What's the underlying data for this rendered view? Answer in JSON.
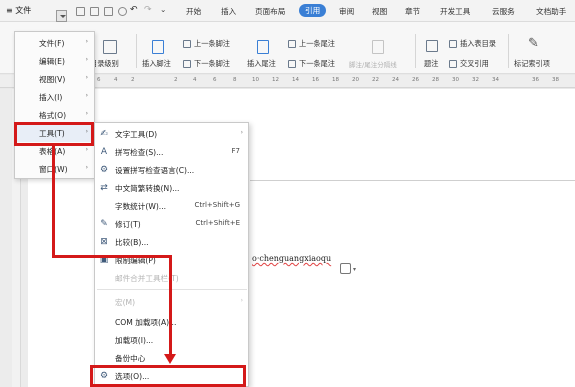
{
  "menubar": {
    "file_label": "≡ 文件",
    "tabs": [
      {
        "label": "开始"
      },
      {
        "label": "插入"
      },
      {
        "label": "页面布局"
      },
      {
        "label": "引用"
      },
      {
        "label": "审阅"
      },
      {
        "label": "视图"
      },
      {
        "label": "章节"
      },
      {
        "label": "开发工具"
      },
      {
        "label": "云服务"
      },
      {
        "label": "文档助手"
      }
    ],
    "active_tab": "引用"
  },
  "ribbon": {
    "toc_level": "目录级别",
    "insert_footnote": "插入脚注",
    "prev_footnote": "上一条脚注",
    "next_footnote": "下一条脚注",
    "insert_endnote": "插入尾注",
    "prev_endnote": "上一条尾注",
    "next_endnote": "下一条尾注",
    "footnote_separator": "脚注/尾注分隔线",
    "caption": "题注",
    "insert_table_of_figures": "插入表目录",
    "cross_reference": "交叉引用",
    "mark_index_entry": "标记索引项"
  },
  "ruler": {
    "numbers": [
      "6",
      "4",
      "2",
      "2",
      "4",
      "6",
      "8",
      "10",
      "12",
      "14",
      "16",
      "18",
      "20",
      "22",
      "24",
      "26",
      "28",
      "30",
      "32",
      "34",
      "36",
      "38"
    ]
  },
  "file_menu": {
    "items": [
      {
        "label": "文件(F)",
        "has_arrow": true
      },
      {
        "label": "编辑(E)",
        "has_arrow": true
      },
      {
        "label": "视图(V)",
        "has_arrow": true
      },
      {
        "label": "插入(I)",
        "has_arrow": true
      },
      {
        "label": "格式(O)",
        "has_arrow": true
      },
      {
        "label": "工具(T)",
        "has_arrow": true
      },
      {
        "label": "表格(A)",
        "has_arrow": true
      },
      {
        "label": "窗口(W)",
        "has_arrow": true
      }
    ],
    "arrow_glyph": "›"
  },
  "tools_menu": {
    "items": [
      {
        "label": "文字工具(D)",
        "icon": "text-tool-icon",
        "shortcut": "",
        "arrow": "›",
        "disabled": false
      },
      {
        "label": "拼写检查(S)...",
        "icon": "spell-check-icon",
        "shortcut": "F7",
        "arrow": "",
        "disabled": false
      },
      {
        "label": "设置拼写检查语言(C)...",
        "icon": "spell-language-icon",
        "shortcut": "",
        "arrow": "",
        "disabled": false
      },
      {
        "label": "中文简繁转换(N)...",
        "icon": "chinese-convert-icon",
        "shortcut": "",
        "arrow": "",
        "disabled": false
      },
      {
        "label": "字数统计(W)...",
        "icon": "",
        "shortcut": "Ctrl+Shift+G",
        "arrow": "",
        "disabled": false
      },
      {
        "label": "修订(T)",
        "icon": "revision-icon",
        "shortcut": "Ctrl+Shift+E",
        "arrow": "",
        "disabled": false
      },
      {
        "label": "比较(B)...",
        "icon": "compare-icon",
        "shortcut": "",
        "arrow": "",
        "disabled": false
      },
      {
        "label": "限制编辑(P)",
        "icon": "restrict-edit-icon",
        "shortcut": "",
        "arrow": "",
        "disabled": false
      },
      {
        "label": "邮件合并工具栏(T)",
        "icon": "",
        "shortcut": "",
        "arrow": "",
        "disabled": true
      },
      {
        "label": "宏(M)",
        "icon": "",
        "shortcut": "",
        "arrow": "›",
        "disabled": true
      },
      {
        "label": "COM 加载项(A)...",
        "icon": "",
        "shortcut": "",
        "arrow": "",
        "disabled": false
      },
      {
        "label": "加载项(I)...",
        "icon": "",
        "shortcut": "",
        "arrow": "",
        "disabled": false
      },
      {
        "label": "备份中心",
        "icon": "",
        "shortcut": "",
        "arrow": "",
        "disabled": false
      },
      {
        "label": "选项(O)...",
        "icon": "options-icon",
        "shortcut": "",
        "arrow": "",
        "disabled": false
      }
    ]
  },
  "document": {
    "text": "o·chenguangxiaoqu"
  },
  "annotation_color": "#d41919",
  "accent_color": "#3a7fd5"
}
